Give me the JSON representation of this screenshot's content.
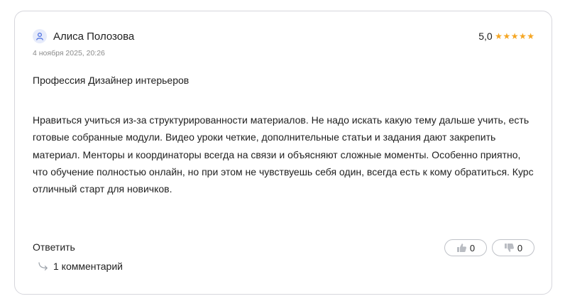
{
  "review": {
    "author": "Алиса Полозова",
    "date": "4 ноября 2025, 20:26",
    "rating_value": "5,0",
    "rating_stars": 5,
    "profession": "Профессия Дизайнер интерьеров",
    "text": "Нравиться учиться из-за структурированности материалов. Не надо искать какую тему дальше учить, есть готовые собранные модули. Видео уроки четкие, дополнительные статьи и задания дают закрепить материал. Менторы и координаторы всегда на связи и объясняют сложные моменты. Особенно приятно, что обучение полностью онлайн, но при этом не чувствуешь себя один, всегда есть к кому обратиться. Курс отличный старт для новичков."
  },
  "actions": {
    "reply_label": "Ответить",
    "comments_label": "1 комментарий",
    "likes": "0",
    "dislikes": "0"
  },
  "icons": {
    "avatar": "user-icon",
    "star": "star-icon",
    "comments": "reply-arrow-icon",
    "like": "thumbs-up-icon",
    "dislike": "thumbs-down-icon"
  },
  "colors": {
    "star": "#f5a623",
    "avatar_bg": "#e6ebfb",
    "avatar_icon": "#4a6ee0",
    "date": "#8a8a8a",
    "border": "#d6d6dc",
    "thumb": "#b9bcc2"
  }
}
